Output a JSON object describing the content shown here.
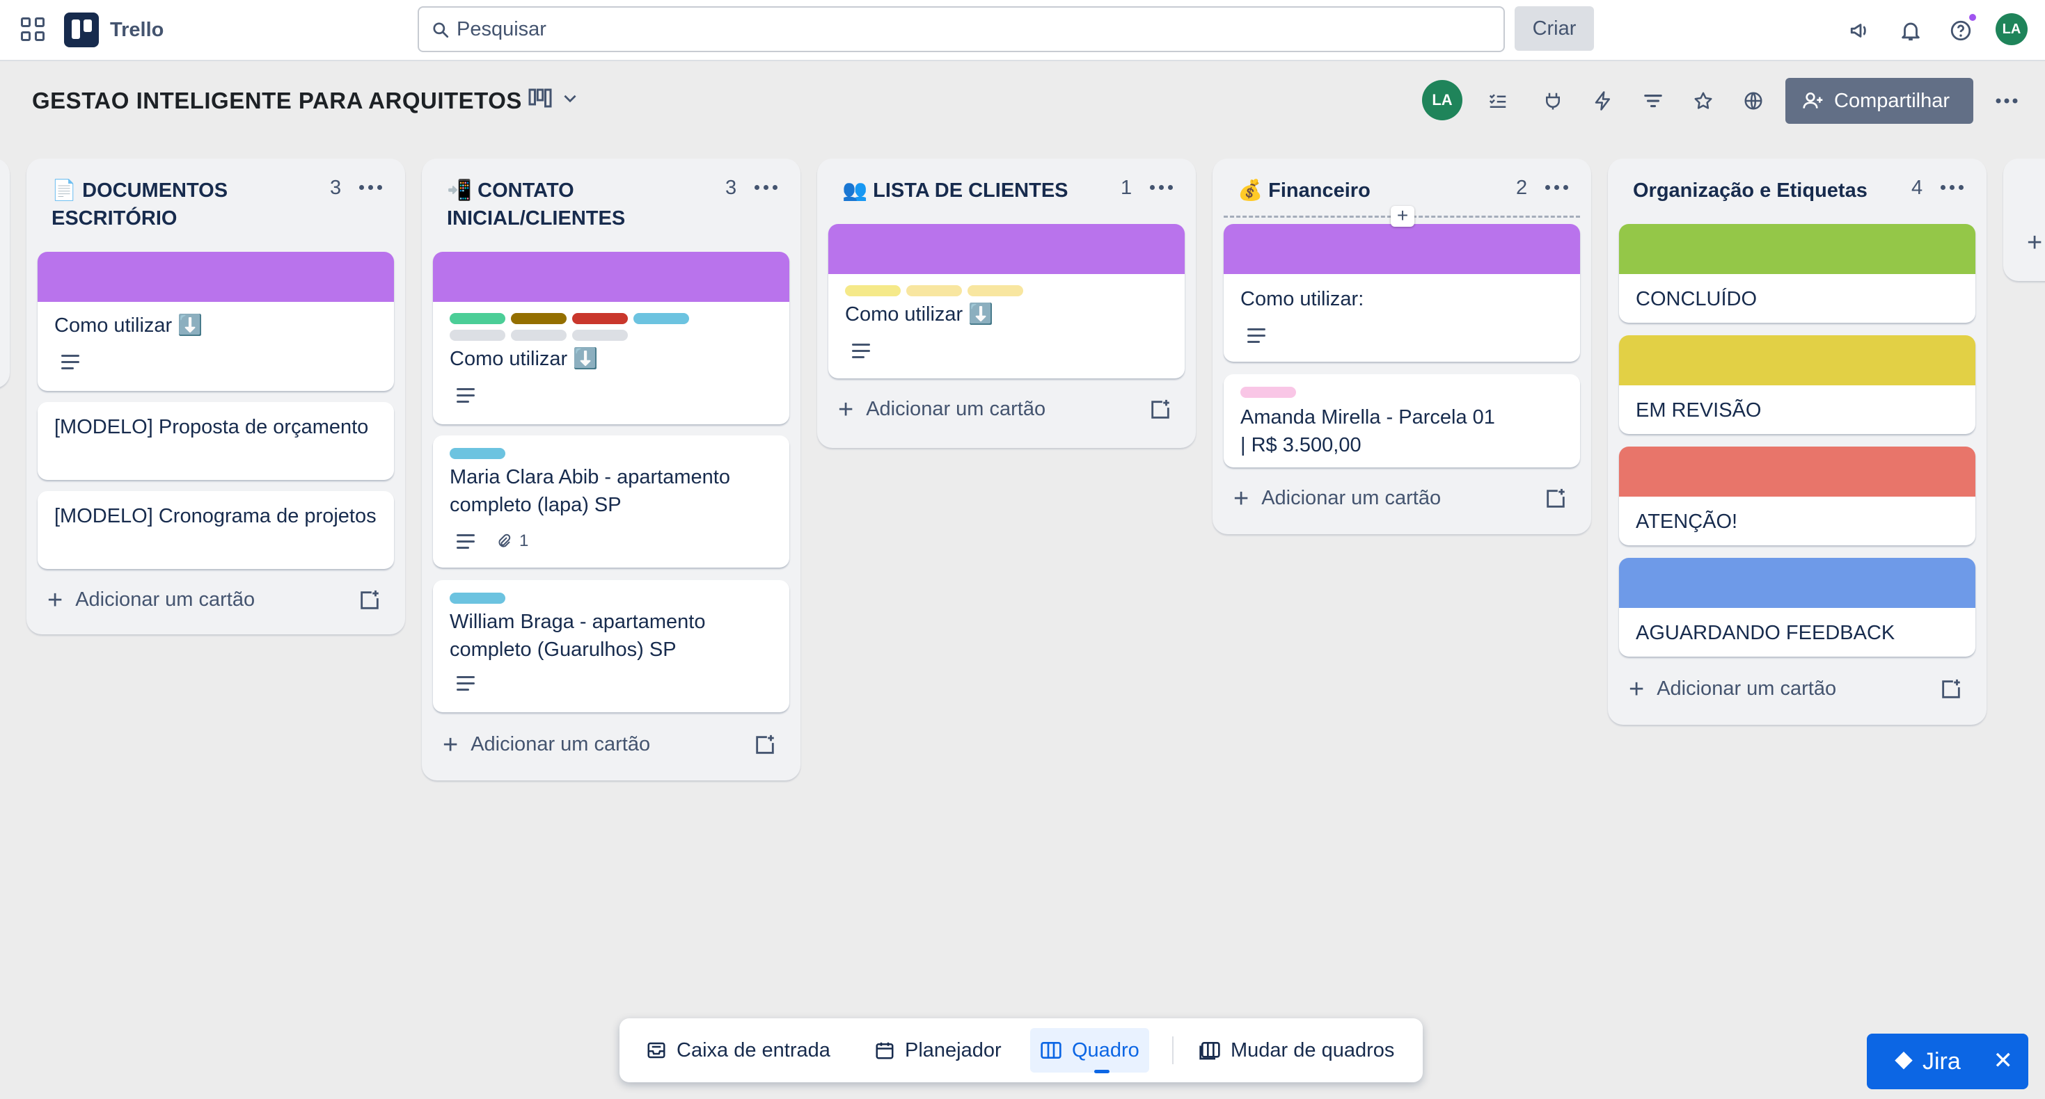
{
  "app": {
    "name": "Trello"
  },
  "topbar": {
    "search_placeholder": "Pesquisar",
    "create_label": "Criar",
    "avatar_initials": "LA"
  },
  "board": {
    "title": "GESTAO INTELIGENTE PARA ARQUITETOS",
    "avatar_initials": "LA",
    "share_label": "Compartilhar"
  },
  "lists": [
    {
      "title": "📄 DOCUMENTOS ESCRITÓRIO",
      "count": "3",
      "add_label": "Adicionar um cartão",
      "cards": [
        {
          "title": "Como utilizar ⬇️",
          "cover": "#b973ec"
        },
        {
          "title": "[MODELO] Proposta de orçamento"
        },
        {
          "title": "[MODELO] Cronograma de projetos"
        }
      ]
    },
    {
      "title": "📲 CONTATO INICIAL/CLIENTES",
      "count": "3",
      "add_label": "Adicionar um cartão",
      "cards": [
        {
          "title": "Como utilizar ⬇️",
          "cover": "#b973ec"
        },
        {
          "title": "Maria Clara Abib - apartamento completo (lapa) SP",
          "attachments": "1"
        },
        {
          "title": "William Braga - apartamento completo (Guarulhos) SP"
        }
      ]
    },
    {
      "title": "👥 LISTA DE CLIENTES",
      "count": "1",
      "add_label": "Adicionar um cartão",
      "cards": [
        {
          "title": "Como utilizar ⬇️",
          "cover": "#b973ec"
        }
      ]
    },
    {
      "title": "💰 Financeiro",
      "count": "2",
      "add_label": "Adicionar um cartão",
      "cards": [
        {
          "title": "Como utilizar:",
          "cover": "#b973ec"
        },
        {
          "title": "Amanda Mirella - Parcela 01 | R$ 3.500,00"
        }
      ]
    },
    {
      "title": "Organização e Etiquetas",
      "count": "4",
      "add_label": "Adicionar um cartão",
      "cards": [
        {
          "title": "CONCLUÍDO",
          "cover": "#94c748"
        },
        {
          "title": "EM REVISÃO",
          "cover": "#e2d045"
        },
        {
          "title": "ATENÇÃO!",
          "cover": "#e8756a"
        },
        {
          "title": "AGUARDANDO FEEDBACK",
          "cover": "#6e9ae8"
        }
      ]
    }
  ],
  "bottom_nav": {
    "inbox": "Caixa de entrada",
    "planner": "Planejador",
    "board": "Quadro",
    "switch": "Mudar de quadros"
  },
  "jira": {
    "label": "Jira"
  }
}
